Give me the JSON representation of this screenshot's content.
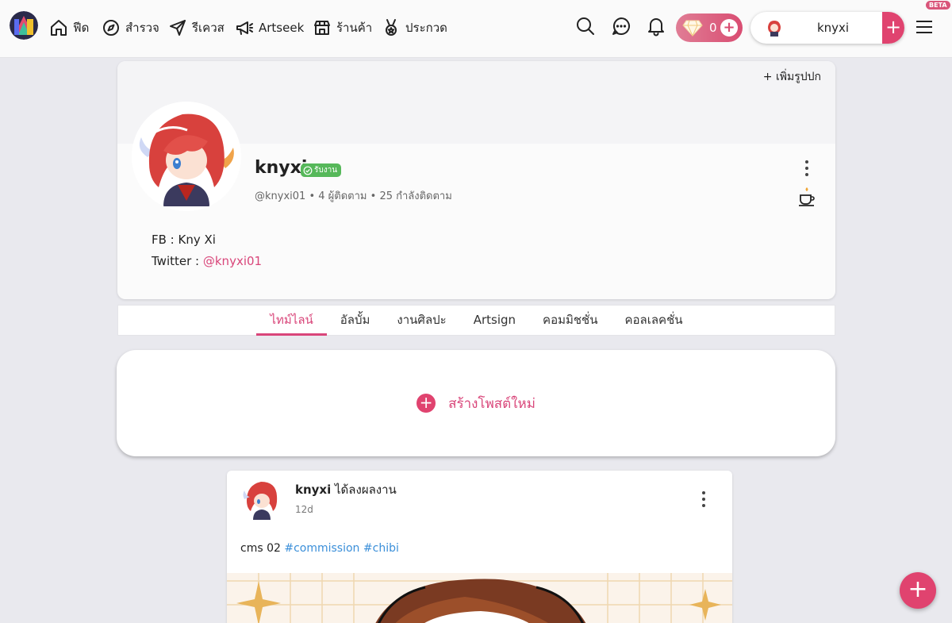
{
  "nav": {
    "feed": "ฟีด",
    "explore": "สำรวจ",
    "request": "รีเควส",
    "artseek": "Artseek",
    "shop": "ร้านค้า",
    "contest": "ประกวด"
  },
  "header": {
    "gem_count": "0",
    "username": "knyxi",
    "beta_label": "BETA"
  },
  "profile": {
    "add_cover": "+ เพิ่มรูปปก",
    "name": "knyxi",
    "status_badge": "รับงาน",
    "handle": "@knyxi01",
    "followers": "4 ผู้ติดตาม",
    "following": "25 กำลังติดตาม",
    "bio_line1": "FB : Kny Xi",
    "bio_twitter_label": "Twitter : ",
    "bio_twitter_link": "@knyxi01"
  },
  "tabs": [
    "ไทม์ไลน์",
    "อัลบั้ม",
    "งานศิลปะ",
    "Artsign",
    "คอมมิชชั่น",
    "คอลเลคชั่น"
  ],
  "active_tab": "ไทม์ไลน์",
  "create_post": {
    "label": "สร้างโพสต์ใหม่"
  },
  "post": {
    "author": "knyxi",
    "action": " ได้ลงผลงาน",
    "time": "12d",
    "text": "cms 02",
    "tags": [
      "#commission",
      "#chibi"
    ]
  },
  "colors": {
    "accent": "#e0436f",
    "link": "#d9467a",
    "hashtag": "#3b8fd9",
    "badge_green": "#56b85a",
    "page_bg": "#e9e9ee"
  },
  "icons": {
    "feed": "home-icon",
    "explore": "compass-icon",
    "request": "send-icon",
    "artseek": "megaphone-icon",
    "shop": "store-icon",
    "contest": "medal-icon"
  }
}
